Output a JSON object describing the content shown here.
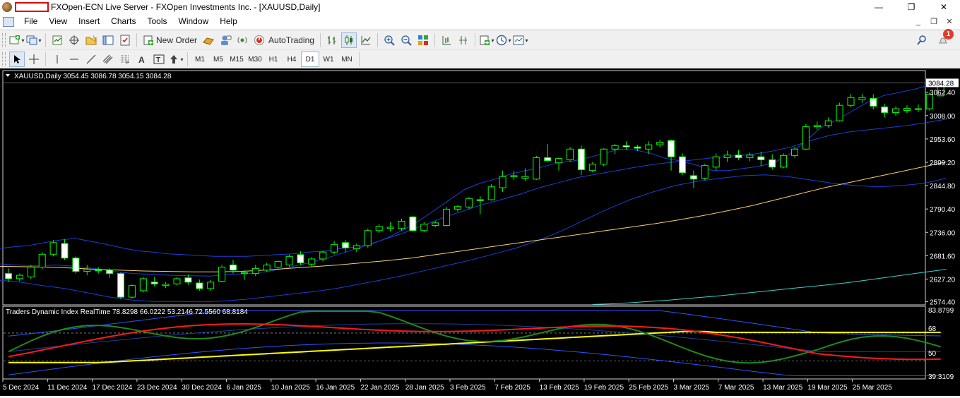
{
  "window": {
    "title": "FXOpen-ECN Live Server - FXOpen Investments Inc. - [XAUUSD,Daily]",
    "minimize": "—",
    "maximize": "❐",
    "close": "✕"
  },
  "menu": {
    "items": [
      "File",
      "View",
      "Insert",
      "Charts",
      "Tools",
      "Window",
      "Help"
    ],
    "mdi": [
      "_",
      "❐",
      "✕"
    ]
  },
  "toolbar": {
    "new_order_label": "New Order",
    "autotrading_label": "AutoTrading",
    "notification_count": "1",
    "icons": {
      "new_chart": "new-chart-icon",
      "profiles": "profiles-icon",
      "market_watch": "market-watch-icon",
      "data_window": "data-window-icon",
      "navigator": "navigator-icon",
      "terminal": "terminal-icon",
      "tester": "strategy-tester-icon",
      "search": "search-icon",
      "notifications": "bell-icon"
    }
  },
  "timeframes": {
    "items": [
      "M1",
      "M5",
      "M15",
      "M30",
      "H1",
      "H4",
      "D1",
      "W1",
      "MN"
    ],
    "active": "D1"
  },
  "chart": {
    "symbol_info": "XAUUSD,Daily  3054.45 3086.78 3054.15 3084.28",
    "current_price_label": "3084.28",
    "indicator_info": "Traders Dynamic Index RealTime 78.8298 66.0222 53.2146 72.5560 68.8184",
    "indicator_levels": {
      "max": "83.8799",
      "upper": "68",
      "mid": "50",
      "min": "39.3109"
    },
    "colors": {
      "background": "#000000",
      "bull_body": "#000000",
      "bull_outline": "#00ff00",
      "bear_body": "#ffffff",
      "bollinger": "#1a3fd6",
      "ma_slow": "#f5d06b",
      "ma_long": "#39d3c9",
      "tdi_green": "#1d8a1d",
      "tdi_red": "#ff1a1a",
      "tdi_yellow": "#ffff00",
      "tdi_band": "#2a55ff"
    }
  },
  "chart_data": {
    "type": "candlestick",
    "symbol": "XAUUSD",
    "timeframe": "Daily",
    "ohlc_last": {
      "open": 3054.45,
      "high": 3086.78,
      "low": 3054.15,
      "close": 3084.28
    },
    "y_ticks": [
      3062.4,
      3008.0,
      2953.6,
      2899.2,
      2844.8,
      2790.4,
      2736.0,
      2681.6,
      2627.2,
      2574.4
    ],
    "ylim": [
      2572,
      3108
    ],
    "x_ticks": [
      "5 Dec 2024",
      "11 Dec 2024",
      "17 Dec 2024",
      "23 Dec 2024",
      "30 Dec 2024",
      "6 Jan 2025",
      "10 Jan 2025",
      "16 Jan 2025",
      "22 Jan 2025",
      "28 Jan 2025",
      "3 Feb 2025",
      "7 Feb 2025",
      "13 Feb 2025",
      "19 Feb 2025",
      "25 Feb 2025",
      "3 Mar 2025",
      "7 Mar 2025",
      "13 Mar 2025",
      "19 Mar 2025",
      "25 Mar 2025"
    ],
    "candles": [
      [
        2640,
        2652,
        2620,
        2628
      ],
      [
        2628,
        2640,
        2622,
        2636
      ],
      [
        2632,
        2660,
        2628,
        2655
      ],
      [
        2655,
        2690,
        2650,
        2685
      ],
      [
        2685,
        2718,
        2680,
        2712
      ],
      [
        2710,
        2720,
        2672,
        2676
      ],
      [
        2676,
        2680,
        2640,
        2645
      ],
      [
        2645,
        2660,
        2636,
        2650
      ],
      [
        2648,
        2655,
        2640,
        2648
      ],
      [
        2648,
        2652,
        2630,
        2640
      ],
      [
        2640,
        2643,
        2580,
        2585
      ],
      [
        2585,
        2615,
        2582,
        2612
      ],
      [
        2600,
        2632,
        2596,
        2628
      ],
      [
        2620,
        2632,
        2610,
        2616
      ],
      [
        2612,
        2620,
        2606,
        2615
      ],
      [
        2616,
        2632,
        2612,
        2628
      ],
      [
        2630,
        2638,
        2614,
        2620
      ],
      [
        2618,
        2626,
        2600,
        2605
      ],
      [
        2605,
        2625,
        2600,
        2620
      ],
      [
        2622,
        2660,
        2620,
        2655
      ],
      [
        2660,
        2672,
        2640,
        2648
      ],
      [
        2640,
        2648,
        2625,
        2642
      ],
      [
        2640,
        2660,
        2634,
        2652
      ],
      [
        2648,
        2665,
        2644,
        2660
      ],
      [
        2655,
        2670,
        2650,
        2668
      ],
      [
        2660,
        2684,
        2656,
        2680
      ],
      [
        2684,
        2692,
        2660,
        2665
      ],
      [
        2662,
        2678,
        2656,
        2674
      ],
      [
        2674,
        2694,
        2668,
        2690
      ],
      [
        2690,
        2716,
        2685,
        2708
      ],
      [
        2712,
        2718,
        2690,
        2700
      ],
      [
        2698,
        2710,
        2690,
        2705
      ],
      [
        2705,
        2745,
        2700,
        2740
      ],
      [
        2740,
        2755,
        2735,
        2750
      ],
      [
        2745,
        2760,
        2738,
        2748
      ],
      [
        2745,
        2768,
        2740,
        2762
      ],
      [
        2772,
        2774,
        2738,
        2740
      ],
      [
        2740,
        2760,
        2736,
        2755
      ],
      [
        2752,
        2762,
        2748,
        2758
      ],
      [
        2752,
        2795,
        2750,
        2790
      ],
      [
        2790,
        2800,
        2784,
        2796
      ],
      [
        2795,
        2818,
        2790,
        2815
      ],
      [
        2812,
        2820,
        2778,
        2810
      ],
      [
        2812,
        2848,
        2810,
        2842
      ],
      [
        2840,
        2880,
        2830,
        2866
      ],
      [
        2866,
        2880,
        2858,
        2868
      ],
      [
        2862,
        2885,
        2855,
        2866
      ],
      [
        2860,
        2914,
        2858,
        2910
      ],
      [
        2910,
        2942,
        2900,
        2903
      ],
      [
        2898,
        2910,
        2880,
        2908
      ],
      [
        2905,
        2935,
        2900,
        2930
      ],
      [
        2930,
        2938,
        2870,
        2882
      ],
      [
        2880,
        2900,
        2876,
        2895
      ],
      [
        2895,
        2932,
        2890,
        2930
      ],
      [
        2930,
        2942,
        2918,
        2938
      ],
      [
        2938,
        2948,
        2928,
        2935
      ],
      [
        2935,
        2940,
        2925,
        2932
      ],
      [
        2930,
        2948,
        2918,
        2940
      ],
      [
        2940,
        2952,
        2934,
        2946
      ],
      [
        2950,
        2952,
        2880,
        2912
      ],
      [
        2912,
        2920,
        2870,
        2875
      ],
      [
        2868,
        2880,
        2840,
        2860
      ],
      [
        2862,
        2895,
        2858,
        2892
      ],
      [
        2888,
        2920,
        2880,
        2912
      ],
      [
        2910,
        2926,
        2900,
        2916
      ],
      [
        2916,
        2928,
        2905,
        2910
      ],
      [
        2910,
        2922,
        2902,
        2916
      ],
      [
        2912,
        2924,
        2890,
        2905
      ],
      [
        2905,
        2918,
        2882,
        2888
      ],
      [
        2888,
        2920,
        2885,
        2915
      ],
      [
        2915,
        2935,
        2910,
        2930
      ],
      [
        2930,
        2988,
        2928,
        2982
      ],
      [
        2982,
        2994,
        2975,
        2985
      ],
      [
        2985,
        3004,
        2980,
        2996
      ],
      [
        2996,
        3038,
        2994,
        3032
      ],
      [
        3032,
        3058,
        3028,
        3050
      ],
      [
        3045,
        3058,
        3038,
        3050
      ],
      [
        3048,
        3058,
        3022,
        3030
      ],
      [
        3028,
        3035,
        3004,
        3015
      ],
      [
        3015,
        3030,
        3008,
        3024
      ],
      [
        3020,
        3032,
        3014,
        3025
      ],
      [
        3024,
        3034,
        3016,
        3024
      ],
      [
        3024,
        3062,
        3020,
        3058
      ],
      [
        3054,
        3087,
        3054,
        3084
      ]
    ],
    "bollinger_upper": [
      2698,
      2702,
      2705,
      2712,
      2718,
      2722,
      2715,
      2708,
      2700,
      2693,
      2690,
      2686,
      2684,
      2682,
      2680,
      2680,
      2680,
      2682,
      2684,
      2686,
      2690,
      2692,
      2698,
      2702,
      2708,
      2722,
      2740,
      2760,
      2785,
      2810,
      2835,
      2850,
      2860,
      2872,
      2880,
      2888,
      2898,
      2902,
      2910,
      2920,
      2930,
      2928,
      2920,
      2908,
      2902,
      2892,
      2880,
      2880,
      2885,
      2890,
      2900,
      2920,
      2950,
      2982,
      2998,
      3020,
      3040,
      3055,
      3062,
      3070,
      3080,
      3090
    ],
    "bollinger_mid": [
      2663,
      2660,
      2658,
      2660,
      2657,
      2652,
      2645,
      2640,
      2638,
      2636,
      2635,
      2634,
      2638,
      2640,
      2645,
      2654,
      2664,
      2676,
      2690,
      2705,
      2720,
      2735,
      2752,
      2770,
      2785,
      2800,
      2812,
      2825,
      2840,
      2852,
      2864,
      2872,
      2880,
      2888,
      2895,
      2900,
      2905,
      2910,
      2914,
      2918,
      2925,
      2935,
      2950,
      2962,
      2970,
      2975,
      2980,
      2985,
      2992,
      3000
    ],
    "bollinger_lower": [
      2625,
      2620,
      2612,
      2605,
      2595,
      2585,
      2578,
      2575,
      2575,
      2574,
      2576,
      2580,
      2586,
      2592,
      2598,
      2605,
      2615,
      2625,
      2636,
      2648,
      2660,
      2672,
      2686,
      2700,
      2718,
      2740,
      2765,
      2790,
      2812,
      2830,
      2845,
      2855,
      2862,
      2868,
      2870,
      2866,
      2858,
      2850,
      2845,
      2842,
      2845,
      2850,
      2862
    ],
    "ma_slow": [
      2657,
      2656,
      2655,
      2653,
      2650,
      2648,
      2646,
      2645,
      2644,
      2644,
      2645,
      2648,
      2652,
      2656,
      2660,
      2665,
      2670,
      2676,
      2684,
      2692,
      2700,
      2708,
      2716,
      2724,
      2732,
      2740,
      2748,
      2756,
      2765,
      2775,
      2786,
      2798,
      2812,
      2826,
      2840,
      2852,
      2864,
      2876,
      2888,
      2900
    ],
    "ma_long": [
      2568,
      2570,
      2574,
      2578,
      2583,
      2588,
      2594,
      2600,
      2606,
      2612,
      2618,
      2626,
      2634,
      2642,
      2650
    ],
    "indicator": {
      "name": "Traders Dynamic Index RealTime",
      "values": [
        78.8298,
        66.0222,
        53.2146,
        72.556,
        68.8184
      ],
      "levels": [
        68,
        50
      ],
      "ylim": [
        39.3109,
        83.8799
      ]
    }
  }
}
